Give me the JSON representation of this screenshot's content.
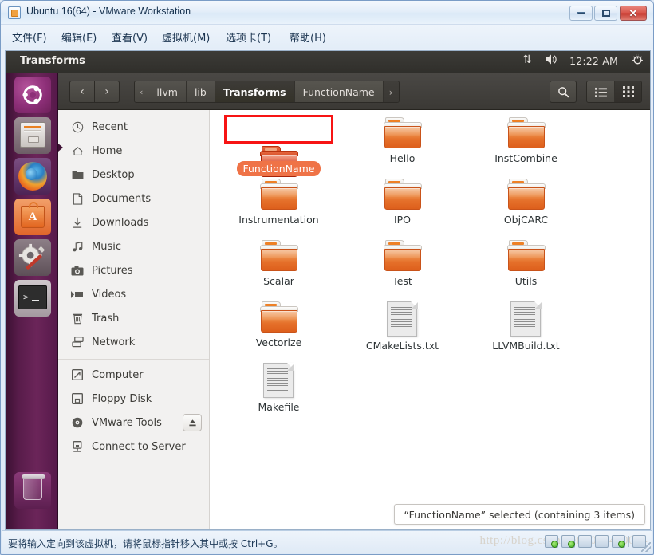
{
  "vmware": {
    "title": "Ubuntu 16(64) - VMware Workstation",
    "title_icon": "vm-app-icon",
    "window_buttons": {
      "minimize": "minimize-icon",
      "maximize": "maximize-icon",
      "close": "✕"
    },
    "menus": [
      {
        "label": "文件(F)",
        "name": "menu-file"
      },
      {
        "label": "编辑(E)",
        "name": "menu-edit"
      },
      {
        "label": "查看(V)",
        "name": "menu-view"
      },
      {
        "label": "虚拟机(M)",
        "name": "menu-vm"
      },
      {
        "label": "选项卡(T)",
        "name": "menu-tabs"
      },
      {
        "label": "帮助(H)",
        "name": "menu-help"
      }
    ],
    "statusbar": {
      "hint": "要将输入定向到该虚拟机，请将鼠标指针移入其中或按 Ctrl+G。",
      "watermark": "http://blog.csdn.net/u012410014"
    }
  },
  "ubuntu_panel": {
    "title": "Transforms",
    "indicators": {
      "network": "⇅",
      "volume": "🔊",
      "clock": "12:22 AM",
      "session": "⏻"
    }
  },
  "launcher": {
    "items": [
      {
        "name": "launcher-dash",
        "label": "Dash Home"
      },
      {
        "name": "launcher-files",
        "label": "Files"
      },
      {
        "name": "launcher-firefox",
        "label": "Firefox Web Browser"
      },
      {
        "name": "launcher-ubuntu-software",
        "label": "Ubuntu Software"
      },
      {
        "name": "launcher-system-settings",
        "label": "System Settings"
      },
      {
        "name": "launcher-terminal",
        "label": "Terminal"
      },
      {
        "name": "launcher-trash",
        "label": "Trash"
      }
    ]
  },
  "nautilus": {
    "toolbar": {
      "back": "‹",
      "forward": "›",
      "search_icon": "search-icon",
      "view_list_icon": "list-view-icon",
      "view_grid_icon": "grid-view-icon"
    },
    "breadcrumb": {
      "prev_ellipsis": "‹",
      "crumbs": [
        {
          "label": "llvm",
          "state": "ancestor"
        },
        {
          "label": "lib",
          "state": "ancestor"
        },
        {
          "label": "Transforms",
          "state": "current"
        },
        {
          "label": "FunctionName",
          "state": "child"
        }
      ],
      "next_ellipsis": "›"
    },
    "sidebar": {
      "group1": [
        {
          "label": "Recent",
          "icon": "clock-icon"
        },
        {
          "label": "Home",
          "icon": "home-icon"
        },
        {
          "label": "Desktop",
          "icon": "folder-icon"
        },
        {
          "label": "Documents",
          "icon": "document-icon"
        },
        {
          "label": "Downloads",
          "icon": "download-icon"
        },
        {
          "label": "Music",
          "icon": "music-note-icon"
        },
        {
          "label": "Pictures",
          "icon": "camera-icon"
        },
        {
          "label": "Videos",
          "icon": "video-icon"
        },
        {
          "label": "Trash",
          "icon": "trash-icon"
        },
        {
          "label": "Network",
          "icon": "network-icon"
        }
      ],
      "group2": [
        {
          "label": "Computer",
          "icon": "computer-icon",
          "eject": false
        },
        {
          "label": "Floppy Disk",
          "icon": "floppy-icon",
          "eject": false
        },
        {
          "label": "VMware Tools",
          "icon": "disc-icon",
          "eject": true,
          "eject_icon": "eject-icon"
        },
        {
          "label": "Connect to Server",
          "icon": "server-icon",
          "eject": false
        }
      ]
    },
    "files": [
      {
        "name": "FunctionName",
        "type": "folder",
        "selected": true
      },
      {
        "name": "Hello",
        "type": "folder",
        "selected": false
      },
      {
        "name": "InstCombine",
        "type": "folder",
        "selected": false
      },
      {
        "name": "Instrumentation",
        "type": "folder",
        "selected": false
      },
      {
        "name": "IPO",
        "type": "folder",
        "selected": false
      },
      {
        "name": "ObjCARC",
        "type": "folder",
        "selected": false
      },
      {
        "name": "Scalar",
        "type": "folder",
        "selected": false
      },
      {
        "name": "Test",
        "type": "folder",
        "selected": false
      },
      {
        "name": "Utils",
        "type": "folder",
        "selected": false
      },
      {
        "name": "Vectorize",
        "type": "folder",
        "selected": false
      },
      {
        "name": "CMakeLists.txt",
        "type": "document",
        "selected": false
      },
      {
        "name": "LLVMBuild.txt",
        "type": "document",
        "selected": false
      },
      {
        "name": "Makefile",
        "type": "document",
        "selected": false
      }
    ],
    "status": "“FunctionName” selected  (containing 3 items)"
  },
  "colors": {
    "selection_outline": "#f71414",
    "label_highlight": "#ef7347",
    "folder_orange": "#e5702a",
    "launcher_purple": "#581c4a",
    "panel_dark": "#3c3b37"
  }
}
